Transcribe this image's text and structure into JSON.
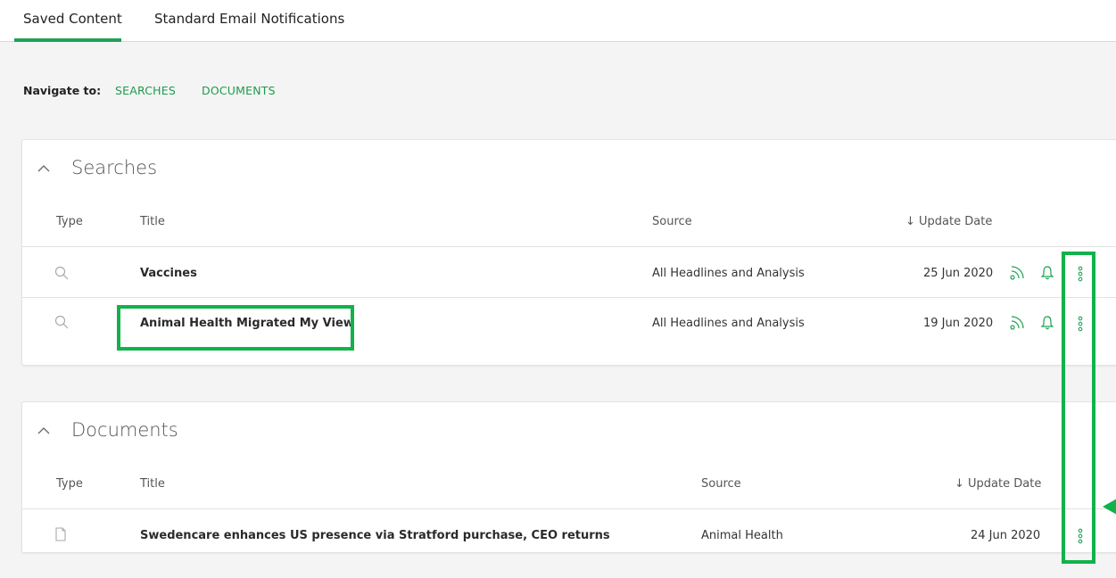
{
  "tabs": [
    {
      "label": "Saved Content",
      "active": true
    },
    {
      "label": "Standard Email Notifications",
      "active": false
    }
  ],
  "navigate": {
    "label": "Navigate to:",
    "links": [
      "SEARCHES",
      "DOCUMENTS"
    ]
  },
  "searches": {
    "title": "Searches",
    "columns": {
      "type": "Type",
      "title": "Title",
      "source": "Source",
      "date": "Update Date"
    },
    "rows": [
      {
        "type_icon": "search-icon",
        "title": "Vaccines",
        "source": "All Headlines and Analysis",
        "date": "25 Jun 2020"
      },
      {
        "type_icon": "search-icon",
        "title": "Animal Health Migrated My View",
        "source": "All Headlines and Analysis",
        "date": "19 Jun 2020"
      }
    ]
  },
  "documents": {
    "title": "Documents",
    "columns": {
      "type": "Type",
      "title": "Title",
      "source": "Source",
      "date": "Update Date"
    },
    "rows": [
      {
        "type_icon": "document-icon",
        "title": "Swedencare enhances US presence via Stratford purchase, CEO returns",
        "source": "Animal Health",
        "date": "24 Jun 2020"
      }
    ]
  },
  "colors": {
    "accent": "#1fa255",
    "highlight": "#12b24a",
    "background": "#f4f4f4"
  }
}
